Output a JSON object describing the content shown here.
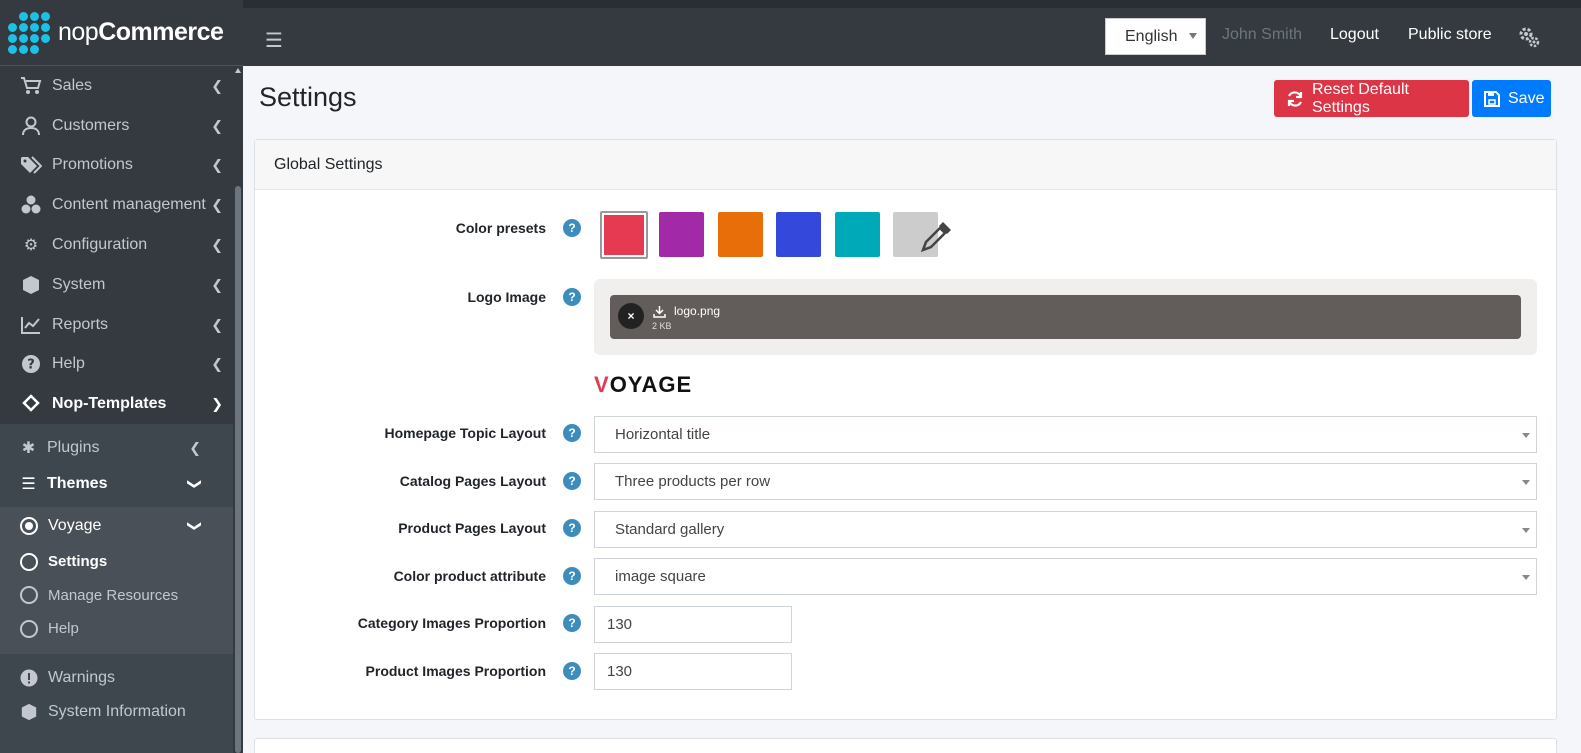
{
  "brand": {
    "name_light": "nop",
    "name_bold": "Commerce"
  },
  "sidebar": {
    "items": [
      {
        "label": "Sales",
        "icon": "cart-icon"
      },
      {
        "label": "Customers",
        "icon": "user-icon"
      },
      {
        "label": "Promotions",
        "icon": "tags-icon"
      },
      {
        "label": "Content management",
        "icon": "cubes-icon"
      },
      {
        "label": "Configuration",
        "icon": "cogs-icon"
      },
      {
        "label": "System",
        "icon": "cube-icon"
      },
      {
        "label": "Reports",
        "icon": "chart-line-icon"
      },
      {
        "label": "Help",
        "icon": "question-circle-icon"
      },
      {
        "label": "Nop-Templates",
        "icon": "layers-icon"
      }
    ],
    "nop_templates_sub": [
      {
        "label": "Plugins",
        "icon": "puzzle-icon"
      },
      {
        "label": "Themes",
        "icon": "layer-group-icon"
      },
      {
        "label": "Voyage",
        "icon": "dot-circle-icon"
      }
    ],
    "voyage_sub": [
      {
        "label": "Settings"
      },
      {
        "label": "Manage Resources"
      },
      {
        "label": "Help"
      }
    ],
    "bottom_items": [
      {
        "label": "Warnings",
        "icon": "exclamation-circle-icon"
      },
      {
        "label": "System Information",
        "icon": "cube-icon"
      }
    ]
  },
  "topbar": {
    "language": "English",
    "user_name": "John Smith",
    "logout": "Logout",
    "public_store": "Public store"
  },
  "page": {
    "title": "Settings",
    "reset_label": "Reset Default Settings",
    "save_label": "Save"
  },
  "card": {
    "header": "Global Settings",
    "rows": {
      "color_presets": "Color presets",
      "logo_image": "Logo Image",
      "homepage_topic_layout": "Homepage Topic Layout",
      "catalog_pages_layout": "Catalog Pages Layout",
      "product_pages_layout": "Product Pages Layout",
      "color_product_attribute": "Color product attribute",
      "category_images_proportion": "Category Images Proportion",
      "product_images_proportion": "Product Images Proportion"
    },
    "help_glyph": "?",
    "colors": {
      "red": "#e63a52",
      "purple": "#a22aa8",
      "orange": "#e86e0a",
      "blue": "#3449dc",
      "teal": "#00a9b7",
      "custom": "#cccccc"
    },
    "logo_file": {
      "name": "logo.png",
      "size": "2 KB",
      "remove_glyph": "×"
    },
    "logo_preview": {
      "first": "V",
      "rest": "OYAGE"
    },
    "values": {
      "homepage_topic_layout": "Horizontal title",
      "catalog_pages_layout": "Three products per row",
      "product_pages_layout": "Standard gallery",
      "color_product_attribute": "image square",
      "category_images_proportion": "130",
      "product_images_proportion": "130"
    }
  }
}
